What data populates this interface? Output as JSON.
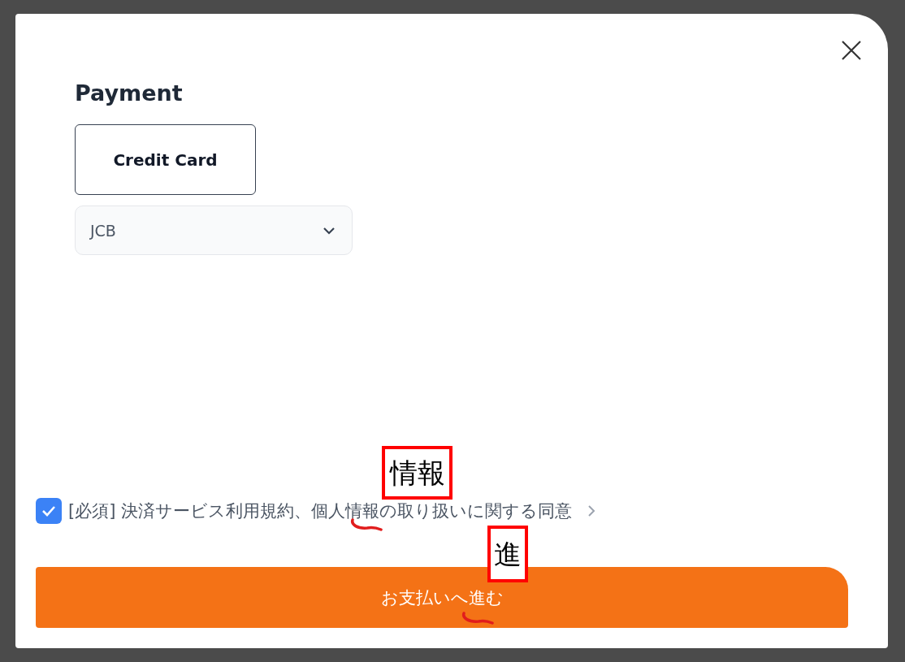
{
  "dialog": {
    "title": "Payment",
    "methods": [
      {
        "label": "Credit Card",
        "selected": true
      }
    ],
    "card_brand": {
      "value": "JCB"
    },
    "consent": {
      "checked": true,
      "text": "[必須] 決済サービス利用規約、個人情報の取り扱いに関する同意"
    },
    "submit": {
      "label": "お支払いへ進む"
    }
  },
  "annotations": [
    {
      "text": "情報"
    },
    {
      "text": "進"
    }
  ]
}
